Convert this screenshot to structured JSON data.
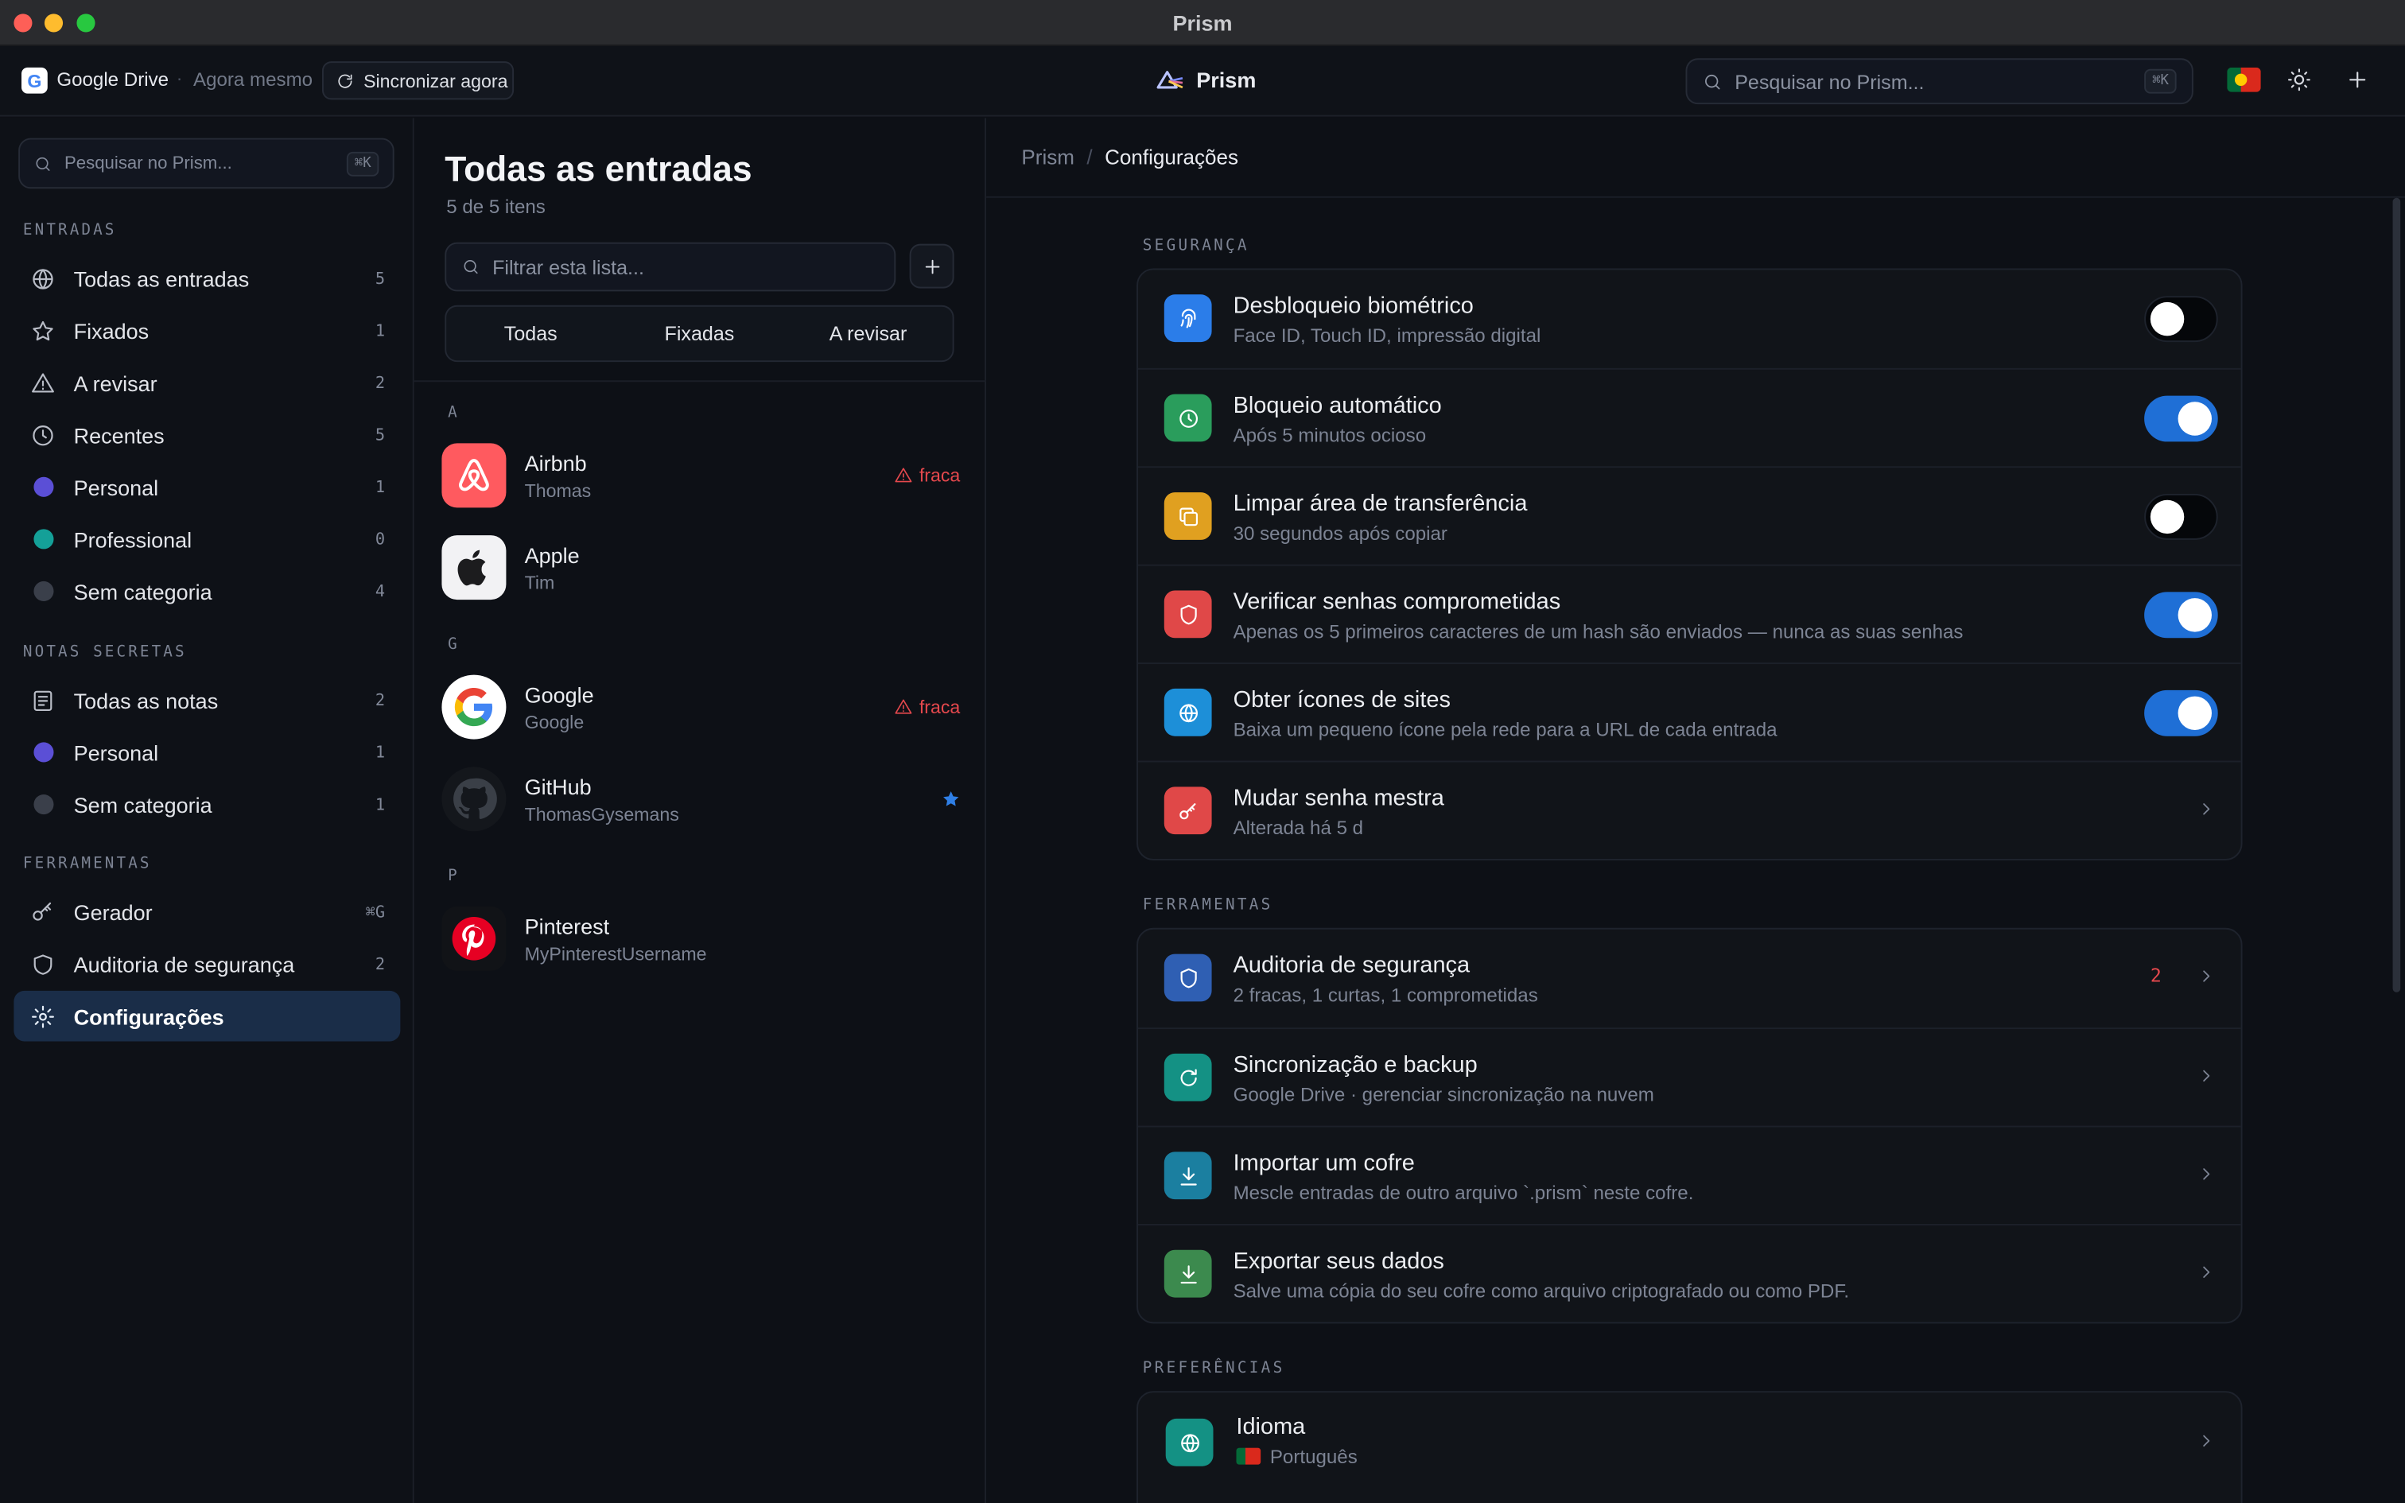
{
  "window": {
    "title": "Prism"
  },
  "topbar": {
    "sync_provider": "Google Drive",
    "separator": "·",
    "last_sync": "Agora mesmo",
    "sync_now": "Sincronizar agora",
    "brand": "Prism",
    "search_placeholder": "Pesquisar no Prism...",
    "search_shortcut": "⌘K",
    "language_flag": "Portugal"
  },
  "sidebar": {
    "search_placeholder": "Pesquisar no Prism...",
    "search_shortcut": "⌘K",
    "sections": [
      {
        "label": "ENTRADAS",
        "items": [
          {
            "label": "Todas as entradas",
            "count": "5",
            "icon": "globe-icon"
          },
          {
            "label": "Fixados",
            "count": "1",
            "icon": "star-icon"
          },
          {
            "label": "A revisar",
            "count": "2",
            "icon": "warning-icon"
          },
          {
            "label": "Recentes",
            "count": "5",
            "icon": "clock-icon"
          },
          {
            "label": "Personal",
            "count": "1",
            "icon": "category-dot",
            "color": "#5b4fd6"
          },
          {
            "label": "Professional",
            "count": "0",
            "icon": "category-dot",
            "color": "#14a098"
          },
          {
            "label": "Sem categoria",
            "count": "4",
            "icon": "category-dot",
            "color": "#3a3f4a"
          }
        ]
      },
      {
        "label": "NOTAS SECRETAS",
        "items": [
          {
            "label": "Todas as notas",
            "count": "2",
            "icon": "note-icon"
          },
          {
            "label": "Personal",
            "count": "1",
            "icon": "category-dot",
            "color": "#5b4fd6"
          },
          {
            "label": "Sem categoria",
            "count": "1",
            "icon": "category-dot",
            "color": "#3a3f4a"
          }
        ]
      },
      {
        "label": "FERRAMENTAS",
        "items": [
          {
            "label": "Gerador",
            "count": "⌘G",
            "icon": "key-icon"
          },
          {
            "label": "Auditoria de segurança",
            "count": "2",
            "icon": "shield-icon"
          },
          {
            "label": "Configurações",
            "count": "",
            "icon": "gear-icon",
            "active": true
          }
        ]
      }
    ]
  },
  "list": {
    "title": "Todas as entradas",
    "subtitle": "5 de 5 itens",
    "filter_placeholder": "Filtrar esta lista...",
    "tabs": [
      "Todas",
      "Fixadas",
      "A revisar"
    ],
    "groups": [
      {
        "letter": "A",
        "entries": [
          {
            "name": "Airbnb",
            "user": "Thomas",
            "status": "fraca",
            "icon": "airbnb-logo-icon"
          },
          {
            "name": "Apple",
            "user": "Tim",
            "status": "",
            "icon": "apple-logo-icon"
          }
        ]
      },
      {
        "letter": "G",
        "entries": [
          {
            "name": "Google",
            "user": "Google",
            "status": "fraca",
            "icon": "google-logo-icon"
          },
          {
            "name": "GitHub",
            "user": "ThomasGysemans",
            "status": "",
            "pinned": true,
            "icon": "github-logo-icon"
          }
        ]
      },
      {
        "letter": "P",
        "entries": [
          {
            "name": "Pinterest",
            "user": "MyPinterestUsername",
            "status": "",
            "icon": "pinterest-logo-icon"
          }
        ]
      }
    ]
  },
  "settings": {
    "breadcrumb": [
      "Prism",
      "Configurações"
    ],
    "breadcrumb_sep": "/",
    "groups": [
      {
        "label": "SEGURANÇA",
        "rows": [
          {
            "title": "Desbloqueio biométrico",
            "subtitle": "Face ID, Touch ID, impressão digital",
            "icon": "fingerprint-icon",
            "icon_color": "#2b7de9",
            "control": "toggle",
            "on": false
          },
          {
            "title": "Bloqueio automático",
            "subtitle": "Após 5 minutos ocioso",
            "icon": "clock-icon",
            "icon_color": "#2a9d5c",
            "control": "toggle",
            "on": true
          },
          {
            "title": "Limpar área de transferência",
            "subtitle": "30 segundos após copiar",
            "icon": "copy-icon",
            "icon_color": "#e0a020",
            "control": "toggle",
            "on": false
          },
          {
            "title": "Verificar senhas comprometidas",
            "subtitle": "Apenas os 5 primeiros caracteres de um hash são enviados — nunca as suas senhas",
            "icon": "shield-icon",
            "icon_color": "#e04848",
            "control": "toggle",
            "on": true
          },
          {
            "title": "Obter ícones de sites",
            "subtitle": "Baixa um pequeno ícone pela rede para a URL de cada entrada",
            "icon": "globe-icon",
            "icon_color": "#1d8fd8",
            "control": "toggle",
            "on": true
          },
          {
            "title": "Mudar senha mestra",
            "subtitle": "Alterada há 5 d",
            "icon": "key-icon",
            "icon_color": "#e04848",
            "control": "chevron"
          }
        ]
      },
      {
        "label": "FERRAMENTAS",
        "rows": [
          {
            "title": "Auditoria de segurança",
            "subtitle": "2 fracas, 1 curtas, 1 comprometidas",
            "icon": "shield-icon",
            "icon_color": "#2f5fb3",
            "control": "chevron",
            "badge": "2"
          },
          {
            "title": "Sincronização e backup",
            "subtitle": "Google Drive · gerenciar sincronização na nuvem",
            "icon": "refresh-icon",
            "icon_color": "#149184",
            "control": "chevron"
          },
          {
            "title": "Importar um cofre",
            "subtitle": "Mescle entradas de outro arquivo `.prism` neste cofre.",
            "icon": "download-icon",
            "icon_color": "#1b7fa0",
            "control": "chevron"
          },
          {
            "title": "Exportar seus dados",
            "subtitle": "Salve uma cópia do seu cofre como arquivo criptografado ou como PDF.",
            "icon": "download-icon",
            "icon_color": "#3c8a4e",
            "control": "chevron"
          }
        ]
      },
      {
        "label": "PREFERÊNCIAS",
        "rows": [
          {
            "title": "Idioma",
            "subtitle": "Português",
            "icon": "globe-icon",
            "icon_color": "#149184",
            "control": "chevron",
            "flag": "Portugal"
          }
        ]
      }
    ]
  }
}
